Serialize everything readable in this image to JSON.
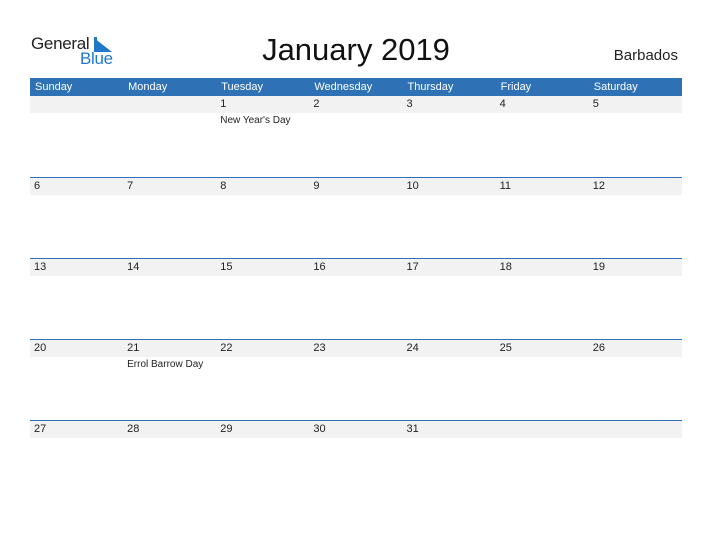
{
  "logo": {
    "line1": "General",
    "line2": "Blue"
  },
  "title": "January 2019",
  "country": "Barbados",
  "weekdays": [
    "Sunday",
    "Monday",
    "Tuesday",
    "Wednesday",
    "Thursday",
    "Friday",
    "Saturday"
  ],
  "weeks": [
    {
      "days": [
        "",
        "",
        "1",
        "2",
        "3",
        "4",
        "5"
      ],
      "events": [
        "",
        "",
        "New Year's Day",
        "",
        "",
        "",
        ""
      ]
    },
    {
      "days": [
        "6",
        "7",
        "8",
        "9",
        "10",
        "11",
        "12"
      ],
      "events": [
        "",
        "",
        "",
        "",
        "",
        "",
        ""
      ]
    },
    {
      "days": [
        "13",
        "14",
        "15",
        "16",
        "17",
        "18",
        "19"
      ],
      "events": [
        "",
        "",
        "",
        "",
        "",
        "",
        ""
      ]
    },
    {
      "days": [
        "20",
        "21",
        "22",
        "23",
        "24",
        "25",
        "26"
      ],
      "events": [
        "",
        "Errol Barrow Day",
        "",
        "",
        "",
        "",
        ""
      ]
    },
    {
      "days": [
        "27",
        "28",
        "29",
        "30",
        "31",
        "",
        ""
      ],
      "events": [
        "",
        "",
        "",
        "",
        "",
        "",
        ""
      ]
    }
  ],
  "colors": {
    "header": "#2e72b5",
    "date_strip": "#f2f2f2",
    "brand_blue": "#1f78c8"
  }
}
